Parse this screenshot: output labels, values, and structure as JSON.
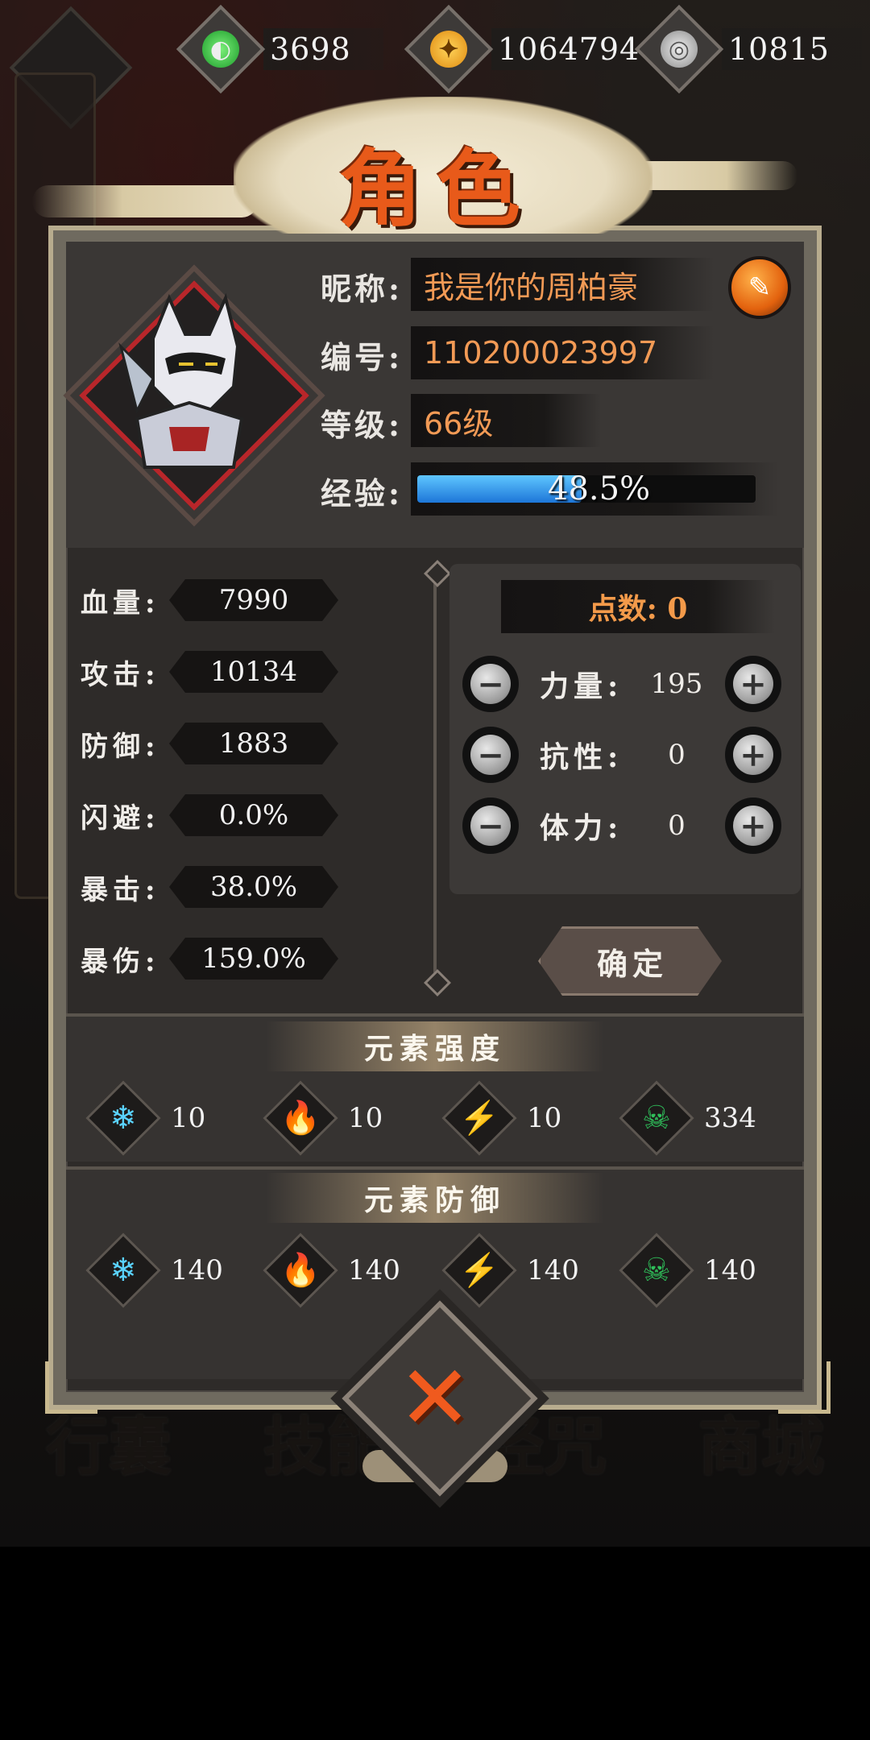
{
  "currencies": [
    {
      "name": "jade",
      "icon": "green-flame-icon",
      "value": "3698",
      "color": "#27c23a"
    },
    {
      "name": "gold",
      "icon": "gold-coin-icon",
      "value": "1064794",
      "color": "#f4a21a"
    },
    {
      "name": "silver",
      "icon": "silver-coin-icon",
      "value": "10815",
      "color": "#bfbfbf"
    }
  ],
  "title": "角色",
  "profile": {
    "nickname_label": "昵称:",
    "nickname": "我是你的周柏豪",
    "id_label": "编号:",
    "id": "110200023997",
    "level_label": "等级:",
    "level": "66级",
    "exp_label": "经验:",
    "exp_text": "48.5%",
    "exp_fraction": 0.485
  },
  "stats": [
    {
      "label": "血量:",
      "value": "7990"
    },
    {
      "label": "攻击:",
      "value": "10134"
    },
    {
      "label": "防御:",
      "value": "1883"
    },
    {
      "label": "闪避:",
      "value": "0.0%"
    },
    {
      "label": "暴击:",
      "value": "38.0%"
    },
    {
      "label": "暴伤:",
      "value": "159.0%"
    }
  ],
  "points": {
    "label": "点数: 0",
    "attributes": [
      {
        "name": "力量:",
        "value": "195"
      },
      {
        "name": "抗性:",
        "value": "0"
      },
      {
        "name": "体力:",
        "value": "0"
      }
    ],
    "minus": "−",
    "plus": "+",
    "confirm": "确定"
  },
  "element_strength": {
    "title": "元素强度",
    "items": [
      {
        "icon": "snowflake-icon",
        "glyph": "❄",
        "color": "#5ad2ff",
        "value": "10"
      },
      {
        "icon": "fire-icon",
        "glyph": "🔥",
        "color": "#ff8a2a",
        "value": "10"
      },
      {
        "icon": "lightning-icon",
        "glyph": "⚡",
        "color": "#b67cf4",
        "value": "10"
      },
      {
        "icon": "poison-skull-icon",
        "glyph": "☠",
        "color": "#2fbf5a",
        "value": "334"
      }
    ]
  },
  "element_defense": {
    "title": "元素防御",
    "items": [
      {
        "icon": "snowflake-icon",
        "glyph": "❄",
        "color": "#5ad2ff",
        "value": "140"
      },
      {
        "icon": "fire-icon",
        "glyph": "🔥",
        "color": "#ff8a2a",
        "value": "140"
      },
      {
        "icon": "lightning-icon",
        "glyph": "⚡",
        "color": "#b67cf4",
        "value": "140"
      },
      {
        "icon": "poison-skull-icon",
        "glyph": "☠",
        "color": "#2fbf5a",
        "value": "140"
      }
    ]
  },
  "background_nav": [
    "行囊",
    "技能",
    "经咒",
    "商城"
  ],
  "close_glyph": "✕"
}
